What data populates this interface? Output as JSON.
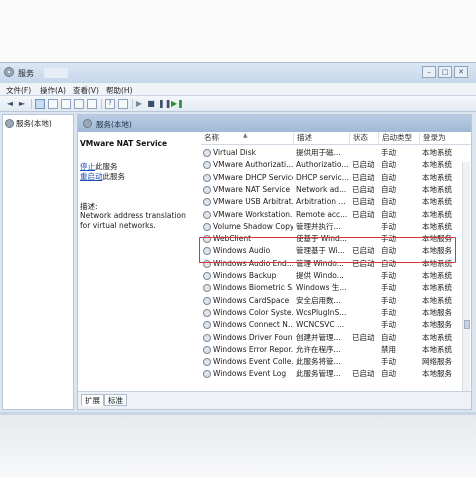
{
  "window": {
    "title": "服务",
    "buttons": [
      "–",
      "□",
      "✕"
    ]
  },
  "menu": [
    "文件(F)",
    "操作(A)",
    "查看(V)",
    "帮助(H)"
  ],
  "toolbar": {
    "back": "◄",
    "forward": "►",
    "play": "▶",
    "stop": "■",
    "pause": "❚❚",
    "restart": "▶❚",
    "help": "?"
  },
  "tree": {
    "root": "服务(本地)"
  },
  "panel": {
    "header": "服务(本地)"
  },
  "detail": {
    "title": "VMware NAT Service",
    "stop_link": "停止",
    "stop_suffix": "此服务",
    "restart_link": "重启动",
    "restart_suffix": "此服务",
    "desc_label": "描述:",
    "desc": "Network address translation for virtual networks."
  },
  "columns": [
    "名称",
    "描述",
    "状态",
    "启动类型",
    "登录为"
  ],
  "services": [
    {
      "name": "Virtual Disk",
      "desc": "提供用于磁...",
      "status": "",
      "startup": "手动",
      "logon": "本地系统"
    },
    {
      "name": "VMware Authorizati...",
      "desc": "Authorizatio...",
      "status": "已启动",
      "startup": "自动",
      "logon": "本地系统"
    },
    {
      "name": "VMware DHCP Service",
      "desc": "DHCP servic...",
      "status": "已启动",
      "startup": "自动",
      "logon": "本地系统"
    },
    {
      "name": "VMware NAT Service",
      "desc": "Network ad...",
      "status": "已启动",
      "startup": "自动",
      "logon": "本地系统"
    },
    {
      "name": "VMware USB Arbitrat...",
      "desc": "Arbitration ...",
      "status": "已启动",
      "startup": "自动",
      "logon": "本地系统"
    },
    {
      "name": "VMware Workstation...",
      "desc": "Remote acc...",
      "status": "已启动",
      "startup": "自动",
      "logon": "本地系统"
    },
    {
      "name": "Volume Shadow Copy",
      "desc": "管理并执行...",
      "status": "",
      "startup": "手动",
      "logon": "本地系统"
    },
    {
      "name": "WebClient",
      "desc": "使基于 Wind...",
      "status": "",
      "startup": "手动",
      "logon": "本地服务"
    },
    {
      "name": "Windows Audio",
      "desc": "管理基于 Wi...",
      "status": "已启动",
      "startup": "自动",
      "logon": "本地服务"
    },
    {
      "name": "Windows Audio End...",
      "desc": "管理 Windo...",
      "status": "已启动",
      "startup": "自动",
      "logon": "本地系统"
    },
    {
      "name": "Windows Backup",
      "desc": "提供 Windo...",
      "status": "",
      "startup": "手动",
      "logon": "本地系统"
    },
    {
      "name": "Windows Biometric S...",
      "desc": "Windows 生...",
      "status": "",
      "startup": "手动",
      "logon": "本地系统"
    },
    {
      "name": "Windows CardSpace",
      "desc": "安全启用数...",
      "status": "",
      "startup": "手动",
      "logon": "本地系统"
    },
    {
      "name": "Windows Color Syste...",
      "desc": "WcsPlugInS...",
      "status": "",
      "startup": "手动",
      "logon": "本地服务"
    },
    {
      "name": "Windows Connect N...",
      "desc": "WCNCSVC ...",
      "status": "",
      "startup": "手动",
      "logon": "本地服务"
    },
    {
      "name": "Windows Driver Foun...",
      "desc": "创建并管理...",
      "status": "已启动",
      "startup": "自动",
      "logon": "本地系统"
    },
    {
      "name": "Windows Error Repor...",
      "desc": "允许在程序...",
      "status": "",
      "startup": "禁用",
      "logon": "本地系统"
    },
    {
      "name": "Windows Event Colle...",
      "desc": "此服务将管...",
      "status": "",
      "startup": "手动",
      "logon": "网络服务"
    },
    {
      "name": "Windows Event Log",
      "desc": "此服务管理...",
      "status": "已启动",
      "startup": "自动",
      "logon": "本地服务"
    }
  ],
  "tabs": [
    "扩展",
    "标准"
  ],
  "highlight_color": "#d8333a"
}
